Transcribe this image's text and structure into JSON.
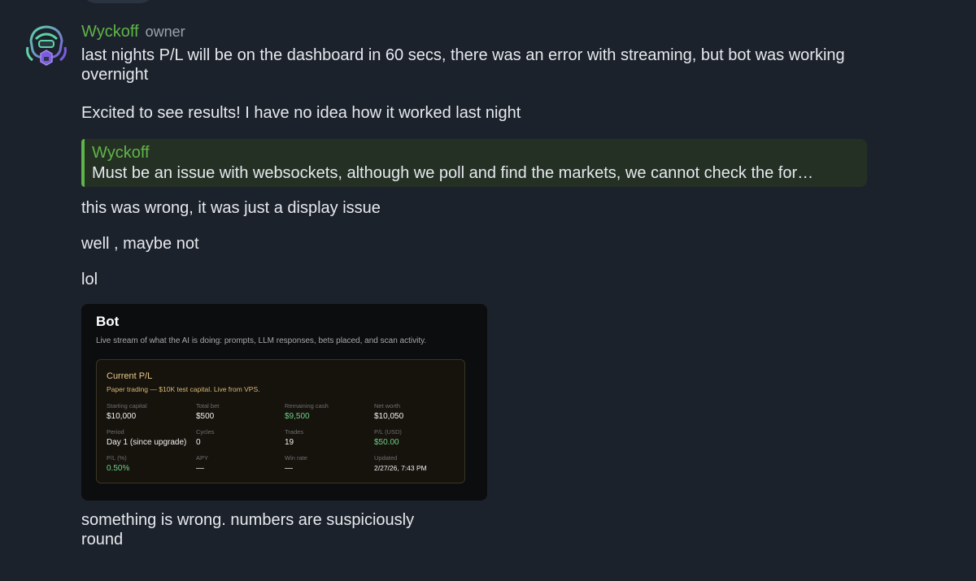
{
  "message": {
    "author": "Wyckoff",
    "role": "owner",
    "paragraphs": [
      "last nights P/L will be on the dashboard in 60 secs, there was an error with streaming, but bot was working overnight",
      "Excited to see results! I have no idea how it worked last night"
    ],
    "quote": {
      "author": "Wyckoff",
      "text": "Must be an issue with websockets, although we poll and find the markets, we cannot check the for…"
    },
    "followups": [
      "this was wrong, it was just a display issue",
      "well , maybe not",
      "lol"
    ],
    "closing": "something is wrong. numbers are suspiciously round"
  },
  "screenshot": {
    "title": "Bot",
    "subtitle": "Live stream of what the AI is doing: prompts, LLM responses, bets placed, and scan activity.",
    "card": {
      "title": "Current P/L",
      "subtitle": "Paper trading — $10K test capital. Live from VPS.",
      "cells": [
        {
          "label": "Starting capital",
          "value": "$10,000"
        },
        {
          "label": "Total bet",
          "value": "$500"
        },
        {
          "label": "Remaining cash",
          "value": "$9,500"
        },
        {
          "label": "Net worth",
          "value": "$10,050"
        },
        {
          "label": "Period",
          "value": "Day 1 (since upgrade)"
        },
        {
          "label": "Cycles",
          "value": "0"
        },
        {
          "label": "Trades",
          "value": "19"
        },
        {
          "label": "P/L (USD)",
          "value": "$50.00"
        },
        {
          "label": "P/L (%)",
          "value": "0.50%"
        },
        {
          "label": "APY",
          "value": "—"
        },
        {
          "label": "Win rate",
          "value": "—"
        },
        {
          "label": "Updated",
          "value": "2/27/26, 7:43 PM"
        }
      ]
    }
  },
  "colors": {
    "background": "#1c222b",
    "author": "#5fb548",
    "positive": "#6ccf86",
    "card_title": "#e8c98a"
  },
  "icons": {
    "avatar": "robot-avatar-icon"
  }
}
